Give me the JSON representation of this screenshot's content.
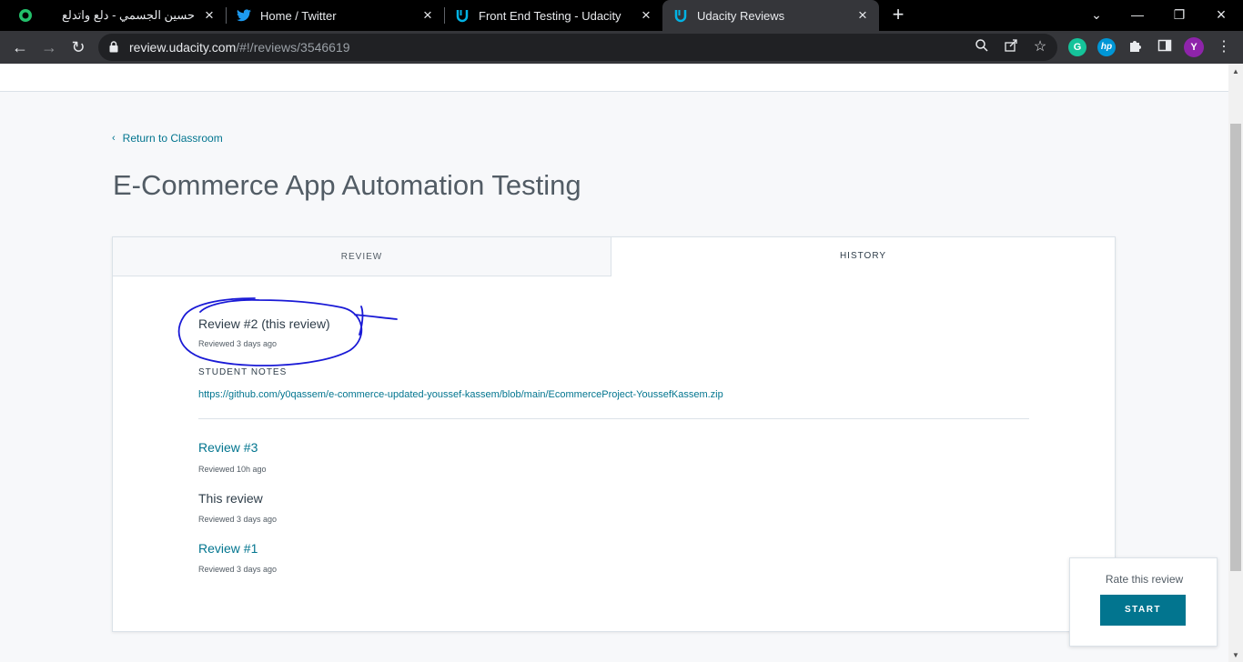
{
  "browser": {
    "tabs": [
      {
        "title": "حسين الجسمي - دلع واتدلع",
        "icon": "green-app-icon",
        "active": false
      },
      {
        "title": "Home / Twitter",
        "icon": "twitter-icon",
        "active": false
      },
      {
        "title": "Front End Testing - Udacity",
        "icon": "udacity-icon",
        "active": false
      },
      {
        "title": "Udacity Reviews",
        "icon": "udacity-icon",
        "active": true
      }
    ],
    "url_host": "review.udacity.com",
    "url_path": "/#!/reviews/3546619",
    "profile_initial": "Y"
  },
  "page": {
    "back_link": "Return to Classroom",
    "title": "E-Commerce App Automation Testing",
    "tabs": {
      "review": "REVIEW",
      "history": "HISTORY"
    }
  },
  "history": {
    "current": {
      "heading": "Review #2 (this review)",
      "meta": "Reviewed 3 days ago",
      "notes_label": "STUDENT NOTES",
      "notes_link": "https://github.com/y0qassem/e-commerce-updated-youssef-kassem/blob/main/EcommerceProject-YoussefKassem.zip"
    },
    "items": [
      {
        "heading": "Review #3",
        "meta": "Reviewed 10h ago"
      },
      {
        "heading": "This review",
        "meta": "Reviewed 3 days ago"
      },
      {
        "heading": "Review #1",
        "meta": "Reviewed 3 days ago"
      }
    ]
  },
  "rate": {
    "title": "Rate this review",
    "button": "START"
  },
  "colors": {
    "accent": "#02758f",
    "annotation": "#1a1ad6"
  }
}
